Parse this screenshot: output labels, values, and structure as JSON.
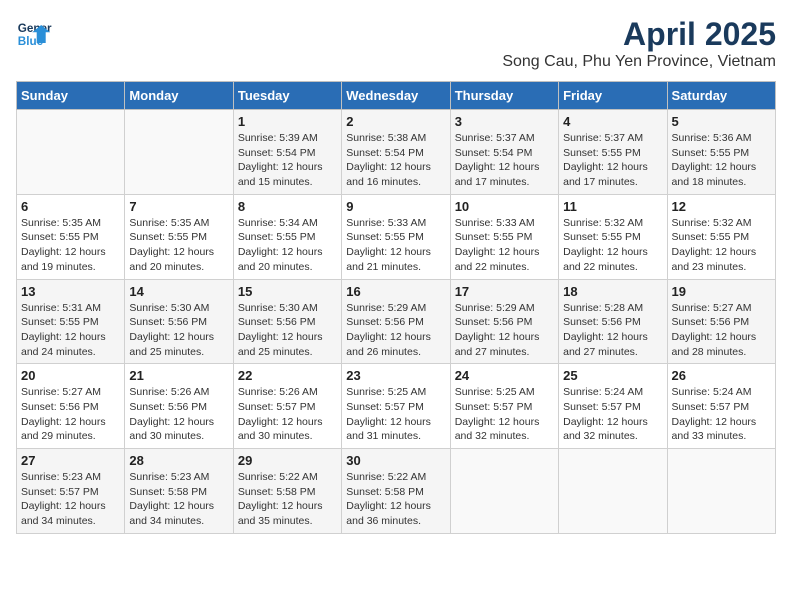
{
  "header": {
    "logo_line1": "General",
    "logo_line2": "Blue",
    "title": "April 2025",
    "subtitle": "Song Cau, Phu Yen Province, Vietnam"
  },
  "days_of_week": [
    "Sunday",
    "Monday",
    "Tuesday",
    "Wednesday",
    "Thursday",
    "Friday",
    "Saturday"
  ],
  "weeks": [
    [
      {
        "day": "",
        "sunrise": "",
        "sunset": "",
        "daylight": ""
      },
      {
        "day": "",
        "sunrise": "",
        "sunset": "",
        "daylight": ""
      },
      {
        "day": "1",
        "sunrise": "Sunrise: 5:39 AM",
        "sunset": "Sunset: 5:54 PM",
        "daylight": "Daylight: 12 hours and 15 minutes."
      },
      {
        "day": "2",
        "sunrise": "Sunrise: 5:38 AM",
        "sunset": "Sunset: 5:54 PM",
        "daylight": "Daylight: 12 hours and 16 minutes."
      },
      {
        "day": "3",
        "sunrise": "Sunrise: 5:37 AM",
        "sunset": "Sunset: 5:54 PM",
        "daylight": "Daylight: 12 hours and 17 minutes."
      },
      {
        "day": "4",
        "sunrise": "Sunrise: 5:37 AM",
        "sunset": "Sunset: 5:55 PM",
        "daylight": "Daylight: 12 hours and 17 minutes."
      },
      {
        "day": "5",
        "sunrise": "Sunrise: 5:36 AM",
        "sunset": "Sunset: 5:55 PM",
        "daylight": "Daylight: 12 hours and 18 minutes."
      }
    ],
    [
      {
        "day": "6",
        "sunrise": "Sunrise: 5:35 AM",
        "sunset": "Sunset: 5:55 PM",
        "daylight": "Daylight: 12 hours and 19 minutes."
      },
      {
        "day": "7",
        "sunrise": "Sunrise: 5:35 AM",
        "sunset": "Sunset: 5:55 PM",
        "daylight": "Daylight: 12 hours and 20 minutes."
      },
      {
        "day": "8",
        "sunrise": "Sunrise: 5:34 AM",
        "sunset": "Sunset: 5:55 PM",
        "daylight": "Daylight: 12 hours and 20 minutes."
      },
      {
        "day": "9",
        "sunrise": "Sunrise: 5:33 AM",
        "sunset": "Sunset: 5:55 PM",
        "daylight": "Daylight: 12 hours and 21 minutes."
      },
      {
        "day": "10",
        "sunrise": "Sunrise: 5:33 AM",
        "sunset": "Sunset: 5:55 PM",
        "daylight": "Daylight: 12 hours and 22 minutes."
      },
      {
        "day": "11",
        "sunrise": "Sunrise: 5:32 AM",
        "sunset": "Sunset: 5:55 PM",
        "daylight": "Daylight: 12 hours and 22 minutes."
      },
      {
        "day": "12",
        "sunrise": "Sunrise: 5:32 AM",
        "sunset": "Sunset: 5:55 PM",
        "daylight": "Daylight: 12 hours and 23 minutes."
      }
    ],
    [
      {
        "day": "13",
        "sunrise": "Sunrise: 5:31 AM",
        "sunset": "Sunset: 5:55 PM",
        "daylight": "Daylight: 12 hours and 24 minutes."
      },
      {
        "day": "14",
        "sunrise": "Sunrise: 5:30 AM",
        "sunset": "Sunset: 5:56 PM",
        "daylight": "Daylight: 12 hours and 25 minutes."
      },
      {
        "day": "15",
        "sunrise": "Sunrise: 5:30 AM",
        "sunset": "Sunset: 5:56 PM",
        "daylight": "Daylight: 12 hours and 25 minutes."
      },
      {
        "day": "16",
        "sunrise": "Sunrise: 5:29 AM",
        "sunset": "Sunset: 5:56 PM",
        "daylight": "Daylight: 12 hours and 26 minutes."
      },
      {
        "day": "17",
        "sunrise": "Sunrise: 5:29 AM",
        "sunset": "Sunset: 5:56 PM",
        "daylight": "Daylight: 12 hours and 27 minutes."
      },
      {
        "day": "18",
        "sunrise": "Sunrise: 5:28 AM",
        "sunset": "Sunset: 5:56 PM",
        "daylight": "Daylight: 12 hours and 27 minutes."
      },
      {
        "day": "19",
        "sunrise": "Sunrise: 5:27 AM",
        "sunset": "Sunset: 5:56 PM",
        "daylight": "Daylight: 12 hours and 28 minutes."
      }
    ],
    [
      {
        "day": "20",
        "sunrise": "Sunrise: 5:27 AM",
        "sunset": "Sunset: 5:56 PM",
        "daylight": "Daylight: 12 hours and 29 minutes."
      },
      {
        "day": "21",
        "sunrise": "Sunrise: 5:26 AM",
        "sunset": "Sunset: 5:56 PM",
        "daylight": "Daylight: 12 hours and 30 minutes."
      },
      {
        "day": "22",
        "sunrise": "Sunrise: 5:26 AM",
        "sunset": "Sunset: 5:57 PM",
        "daylight": "Daylight: 12 hours and 30 minutes."
      },
      {
        "day": "23",
        "sunrise": "Sunrise: 5:25 AM",
        "sunset": "Sunset: 5:57 PM",
        "daylight": "Daylight: 12 hours and 31 minutes."
      },
      {
        "day": "24",
        "sunrise": "Sunrise: 5:25 AM",
        "sunset": "Sunset: 5:57 PM",
        "daylight": "Daylight: 12 hours and 32 minutes."
      },
      {
        "day": "25",
        "sunrise": "Sunrise: 5:24 AM",
        "sunset": "Sunset: 5:57 PM",
        "daylight": "Daylight: 12 hours and 32 minutes."
      },
      {
        "day": "26",
        "sunrise": "Sunrise: 5:24 AM",
        "sunset": "Sunset: 5:57 PM",
        "daylight": "Daylight: 12 hours and 33 minutes."
      }
    ],
    [
      {
        "day": "27",
        "sunrise": "Sunrise: 5:23 AM",
        "sunset": "Sunset: 5:57 PM",
        "daylight": "Daylight: 12 hours and 34 minutes."
      },
      {
        "day": "28",
        "sunrise": "Sunrise: 5:23 AM",
        "sunset": "Sunset: 5:58 PM",
        "daylight": "Daylight: 12 hours and 34 minutes."
      },
      {
        "day": "29",
        "sunrise": "Sunrise: 5:22 AM",
        "sunset": "Sunset: 5:58 PM",
        "daylight": "Daylight: 12 hours and 35 minutes."
      },
      {
        "day": "30",
        "sunrise": "Sunrise: 5:22 AM",
        "sunset": "Sunset: 5:58 PM",
        "daylight": "Daylight: 12 hours and 36 minutes."
      },
      {
        "day": "",
        "sunrise": "",
        "sunset": "",
        "daylight": ""
      },
      {
        "day": "",
        "sunrise": "",
        "sunset": "",
        "daylight": ""
      },
      {
        "day": "",
        "sunrise": "",
        "sunset": "",
        "daylight": ""
      }
    ]
  ]
}
